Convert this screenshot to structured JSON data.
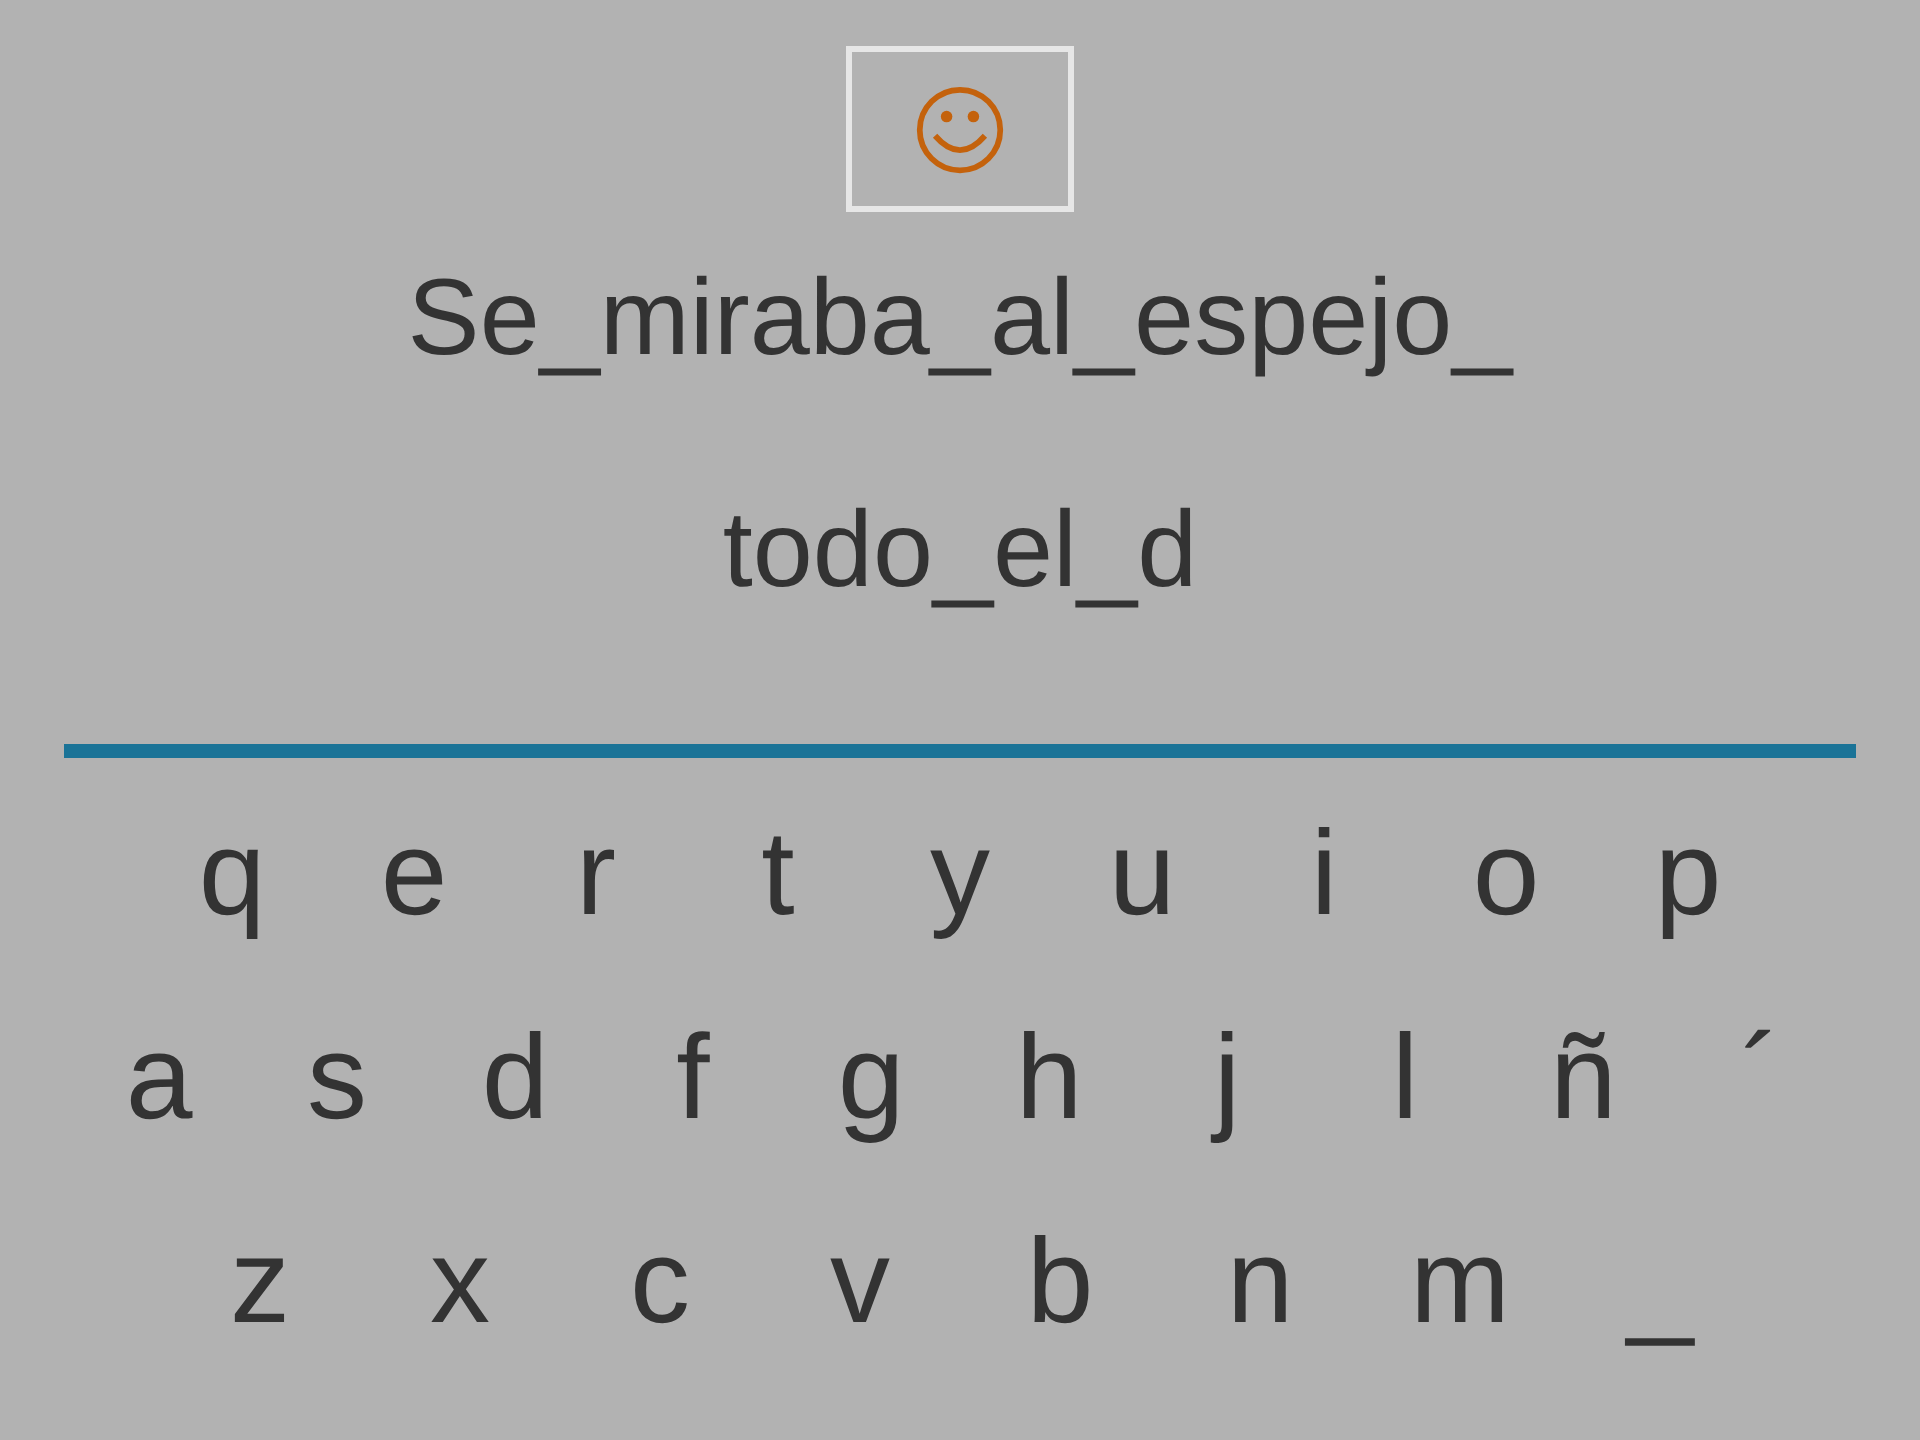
{
  "phrase_lines": [
    "Se_miraba_al_espejo_",
    "todo_el_d"
  ],
  "keyboard_rows": [
    [
      "q",
      "e",
      "r",
      "t",
      "y",
      "u",
      "i",
      "o",
      "p"
    ],
    [
      "a",
      "s",
      "d",
      "f",
      "g",
      "h",
      "j",
      "l",
      "ñ",
      "´"
    ],
    [
      "z",
      "x",
      "c",
      "v",
      "b",
      "n",
      "m",
      "_"
    ]
  ]
}
